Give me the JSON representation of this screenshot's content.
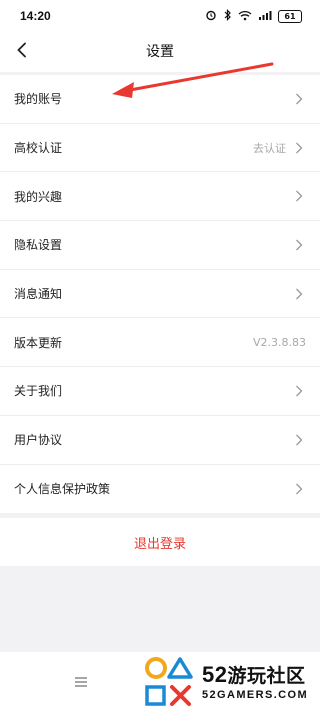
{
  "status_bar": {
    "time": "14:20",
    "battery": "61"
  },
  "header": {
    "title": "设置",
    "back_icon": "chevron-left-icon"
  },
  "settings": [
    {
      "label": "我的账号",
      "value": ""
    },
    {
      "label": "高校认证",
      "value": "去认证"
    },
    {
      "label": "我的兴趣",
      "value": ""
    },
    {
      "label": "隐私设置",
      "value": ""
    },
    {
      "label": "消息通知",
      "value": ""
    },
    {
      "label": "版本更新",
      "value": "V2.3.8.83"
    },
    {
      "label": "关于我们",
      "value": ""
    },
    {
      "label": "用户协议",
      "value": ""
    },
    {
      "label": "个人信息保护政策",
      "value": ""
    }
  ],
  "logout_label": "退出登录",
  "watermark": {
    "number": "52",
    "name": "游玩社区",
    "domain": "52GAMERS.COM"
  },
  "colors": {
    "accent_red": "#e8382f",
    "background": "#f2f2f4"
  }
}
